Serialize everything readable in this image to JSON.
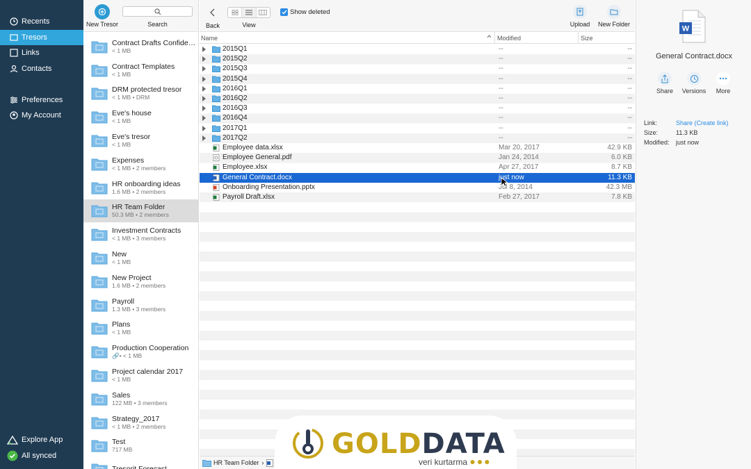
{
  "colors": {
    "sidebar": "#1f3b52",
    "accent": "#31a6dd",
    "selection": "#1a68d3",
    "watermark_gold": "#c8a41a"
  },
  "sidebar": {
    "nav": [
      {
        "label": "Recents",
        "icon": "clock-icon"
      },
      {
        "label": "Tresors",
        "icon": "folder-icon",
        "active": true
      },
      {
        "label": "Links",
        "icon": "link-icon"
      },
      {
        "label": "Contacts",
        "icon": "person-icon"
      }
    ],
    "nav2": [
      {
        "label": "Preferences",
        "icon": "sliders-icon"
      },
      {
        "label": "My Account",
        "icon": "account-icon"
      }
    ],
    "explore": "Explore App",
    "synced": "All synced"
  },
  "tresor_toolbar": {
    "new_tresor": "New Tresor",
    "search": "Search"
  },
  "tresors": [
    {
      "name": "Contract Drafts Confidential",
      "meta": "< 1 MB"
    },
    {
      "name": "Contract Templates",
      "meta": "< 1 MB"
    },
    {
      "name": "DRM protected tresor",
      "meta": "< 1 MB • DRM"
    },
    {
      "name": "Eve's house",
      "meta": "< 1 MB"
    },
    {
      "name": "Eve's tresor",
      "meta": "< 1 MB"
    },
    {
      "name": "Expenses",
      "meta": "< 1 MB • 2 members"
    },
    {
      "name": "HR onboarding ideas",
      "meta": "1.6 MB • 2 members"
    },
    {
      "name": "HR Team Folder",
      "meta": "50.3 MB • 2 members",
      "active": true
    },
    {
      "name": "Investment Contracts",
      "meta": "< 1 MB • 3 members"
    },
    {
      "name": "New",
      "meta": "< 1 MB"
    },
    {
      "name": "New Project",
      "meta": "1.6 MB • 2 members"
    },
    {
      "name": "Payroll",
      "meta": "1.3 MB • 3 members"
    },
    {
      "name": "Plans",
      "meta": "< 1 MB"
    },
    {
      "name": "Production Cooperation",
      "meta": "🔗• < 1 MB"
    },
    {
      "name": "Project calendar 2017",
      "meta": "< 1 MB"
    },
    {
      "name": "Sales",
      "meta": "122 MB • 3 members"
    },
    {
      "name": "Strategy_2017",
      "meta": "< 1 MB • 2 members"
    },
    {
      "name": "Test",
      "meta": "717 MB"
    },
    {
      "name": "Tresorit Forecast",
      "meta": ""
    }
  ],
  "main_toolbar": {
    "back": "Back",
    "view": "View",
    "show_deleted": "Show deleted",
    "upload": "Upload",
    "new_folder": "New Folder"
  },
  "columns": {
    "name": "Name",
    "modified": "Modified",
    "size": "Size"
  },
  "files": [
    {
      "name": "2015Q1",
      "modified": "--",
      "size": "--",
      "type": "folder"
    },
    {
      "name": "2015Q2",
      "modified": "--",
      "size": "--",
      "type": "folder"
    },
    {
      "name": "2015Q3",
      "modified": "--",
      "size": "--",
      "type": "folder"
    },
    {
      "name": "2015Q4",
      "modified": "--",
      "size": "--",
      "type": "folder"
    },
    {
      "name": "2016Q1",
      "modified": "--",
      "size": "--",
      "type": "folder"
    },
    {
      "name": "2016Q2",
      "modified": "--",
      "size": "--",
      "type": "folder"
    },
    {
      "name": "2016Q3",
      "modified": "--",
      "size": "--",
      "type": "folder"
    },
    {
      "name": "2016Q4",
      "modified": "--",
      "size": "--",
      "type": "folder"
    },
    {
      "name": "2017Q1",
      "modified": "--",
      "size": "--",
      "type": "folder"
    },
    {
      "name": "2017Q2",
      "modified": "--",
      "size": "--",
      "type": "folder"
    },
    {
      "name": "Employee data.xlsx",
      "modified": "Mar 20, 2017",
      "size": "42.9 KB",
      "type": "xlsx"
    },
    {
      "name": "Employee General.pdf",
      "modified": "Jan 24, 2014",
      "size": "6.0 KB",
      "type": "pdf"
    },
    {
      "name": "Employee.xlsx",
      "modified": "Apr 27, 2017",
      "size": "8.7 KB",
      "type": "xlsx"
    },
    {
      "name": "General Contract.docx",
      "modified": "just now",
      "size": "11.3 KB",
      "type": "docx",
      "selected": true
    },
    {
      "name": "Onboarding Presentation.pptx",
      "modified": "Jul 8, 2014",
      "size": "42.3 MB",
      "type": "pptx"
    },
    {
      "name": "Payroll Draft.xlsx",
      "modified": "Feb 27, 2017",
      "size": "7.8 KB",
      "type": "xlsx"
    }
  ],
  "breadcrumb": {
    "folder": "HR Team Folder",
    "sep": "›"
  },
  "watermark": {
    "gold": "GOLD",
    "dark": "DATA",
    "sub": "veri kurtarma"
  },
  "details": {
    "file_name": "General Contract.docx",
    "actions": [
      "Share",
      "Versions",
      "More"
    ],
    "link_label": "Link:",
    "link_value": "Share (Create link)",
    "size_label": "Size:",
    "size_value": "11.3 KB",
    "modified_label": "Modified:",
    "modified_value": "just now"
  }
}
